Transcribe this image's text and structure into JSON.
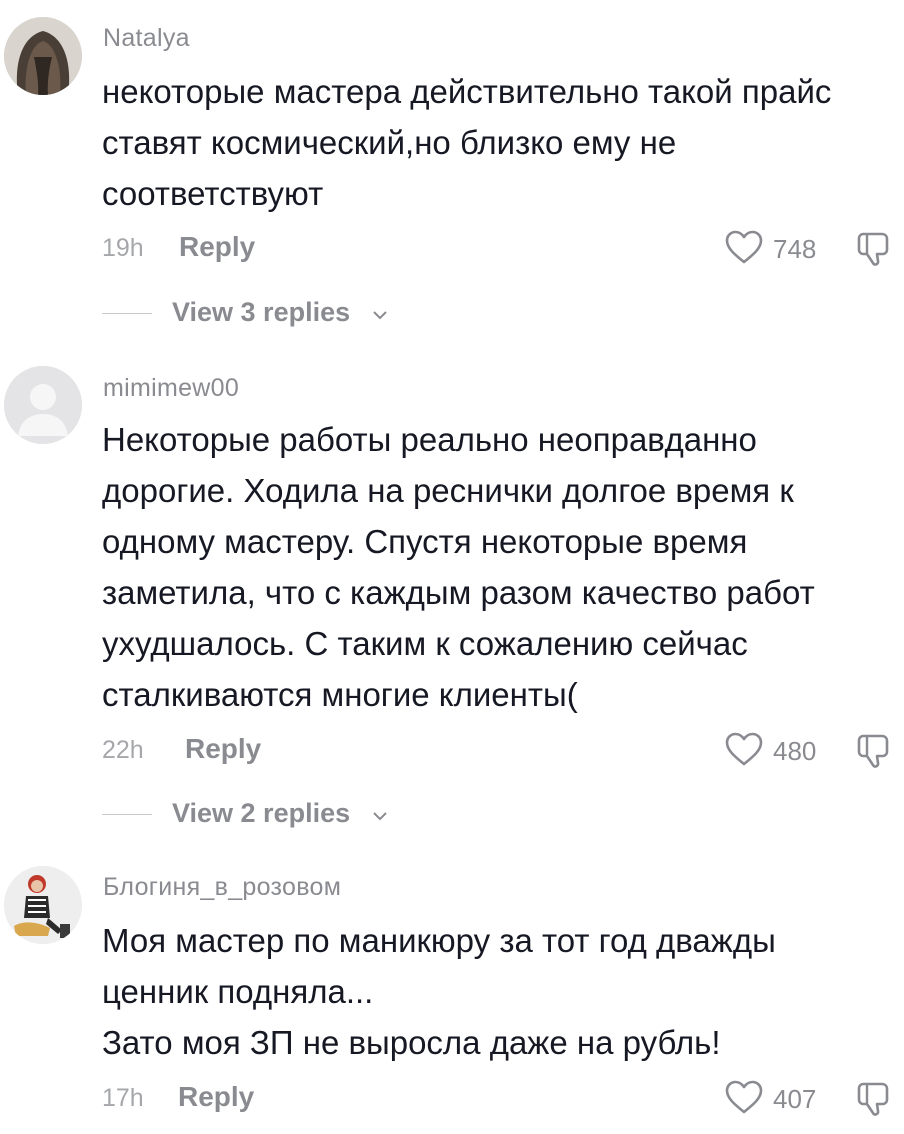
{
  "comments": [
    {
      "username": "Natalya",
      "avatar_icon": "avatar-hair-photo",
      "text_lines": [
        "некоторые мастера действительно такой прайс",
        "ставят космический,но близко ему не",
        "соответствуют"
      ],
      "time": "19h",
      "reply_label": "Reply",
      "likes": "748",
      "view_replies": "View 3 replies"
    },
    {
      "username": "mimimew00",
      "avatar_icon": "default-avatar-icon",
      "text_lines": [
        "Некоторые работы реально неоправданно",
        "дорогие. Ходила на реснички долгое время к",
        "одному мастеру. Спустя некоторые время",
        "заметила, что с каждым разом качество работ",
        "ухудшалось. С таким к сожалению сейчас",
        "сталкиваются многие клиенты("
      ],
      "time": "22h",
      "reply_label": "Reply",
      "likes": "480",
      "view_replies": "View 2 replies"
    },
    {
      "username": "Блогиня_в_розовом",
      "avatar_icon": "avatar-person-photo",
      "text_lines": [
        "Моя мастер по маникюру за тот год дважды",
        "ценник подняла...",
        "Зато моя ЗП не выросла даже на рубль!"
      ],
      "time": "17h",
      "reply_label": "Reply",
      "likes": "407"
    }
  ],
  "icons": {
    "like": "heart-outline-icon",
    "dislike": "thumbs-down-icon",
    "expand": "chevron-down-icon"
  },
  "colors": {
    "text": "#161823",
    "secondary": "#8a8b91",
    "muted": "#a6a7ab"
  }
}
